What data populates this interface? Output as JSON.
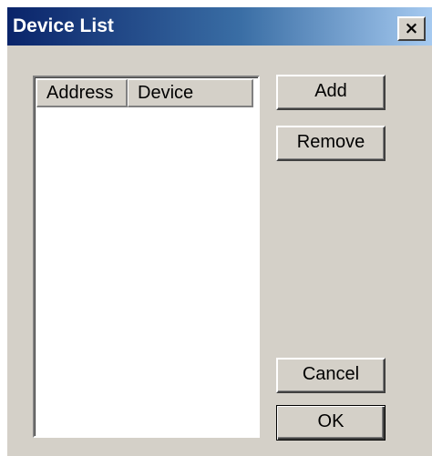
{
  "window": {
    "title": "Device List",
    "close_glyph": "×",
    "close_icon": "close-icon"
  },
  "listview": {
    "columns": [
      {
        "label": "Address"
      },
      {
        "label": "Device"
      }
    ],
    "rows": []
  },
  "buttons": {
    "add": "Add",
    "remove": "Remove",
    "cancel": "Cancel",
    "ok": "OK"
  },
  "colors": {
    "titlebar_start": "#0a246a",
    "titlebar_end": "#a6caf0",
    "face": "#d4d0c8"
  }
}
